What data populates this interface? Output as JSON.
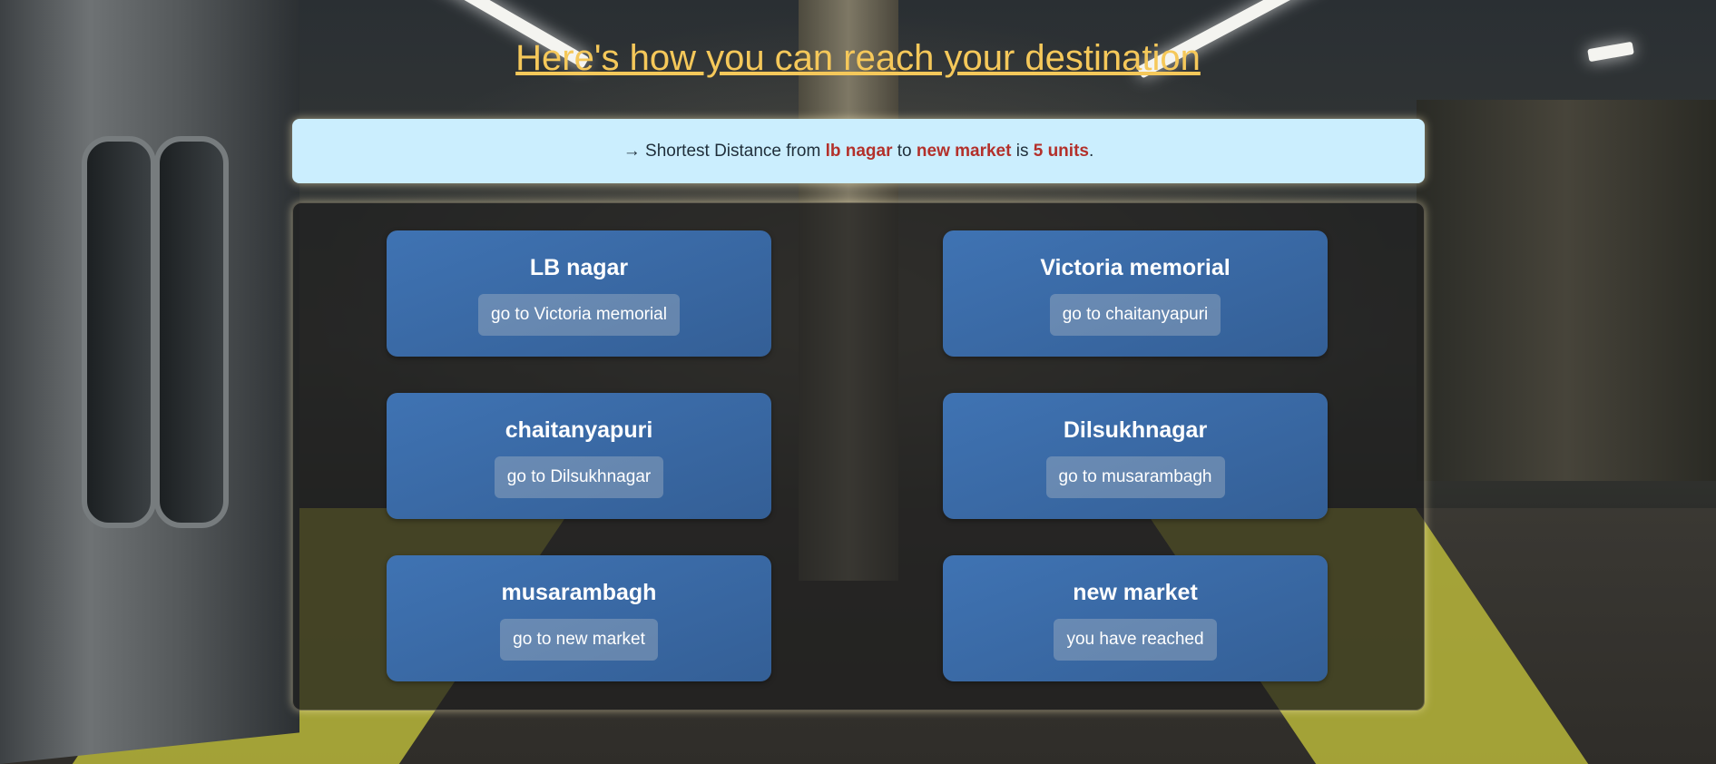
{
  "title": "Here's how you can reach your destination",
  "summary": {
    "prefix": "→ Shortest Distance from",
    "source": "lb nagar",
    "to_word": "to",
    "destination": "new market",
    "is_word": "is",
    "distance": "5 units",
    "suffix": "."
  },
  "route": [
    {
      "station": "LB nagar",
      "step": "go to Victoria memorial"
    },
    {
      "station": "Victoria memorial",
      "step": "go to chaitanyapuri"
    },
    {
      "station": "chaitanyapuri",
      "step": "go to Dilsukhnagar"
    },
    {
      "station": "Dilsukhnagar",
      "step": "go to musarambagh"
    },
    {
      "station": "musarambagh",
      "step": "go to new market"
    },
    {
      "station": "new market",
      "step": "you have reached"
    }
  ],
  "colors": {
    "title": "#f5c85a",
    "banner_bg": "#cbeefe",
    "highlight": "#b3302b",
    "card_bg": "#3f73b3"
  }
}
